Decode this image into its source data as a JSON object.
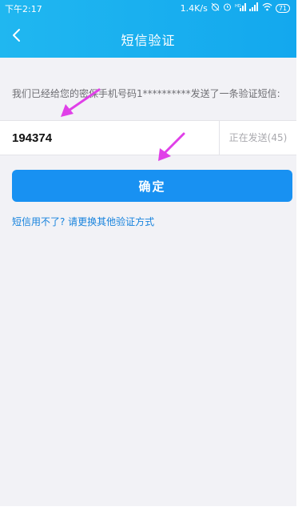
{
  "status_bar": {
    "time": "下午2:17",
    "network_speed": "1.4K/s",
    "battery": "71",
    "icons": [
      "alarm-off-icon",
      "alarm-icon",
      "hd-signal-icon",
      "signal-icon",
      "wifi-icon",
      "battery-icon"
    ]
  },
  "nav": {
    "title": "短信验证",
    "back_icon": "chevron-left-icon"
  },
  "message": {
    "text": "我们已经给您的密保手机号码1**********发送了一条验证短信:"
  },
  "code_input": {
    "value": "194374"
  },
  "resend": {
    "label": "正在发送(45)"
  },
  "confirm_button": {
    "label": "确定"
  },
  "alt_link": {
    "label": "短信用不了? 请更换其他验证方式"
  },
  "colors": {
    "header": "#1aaef0",
    "primary_button": "#1891f2",
    "link": "#1783dd",
    "annotation_arrow": "#e040e8"
  }
}
